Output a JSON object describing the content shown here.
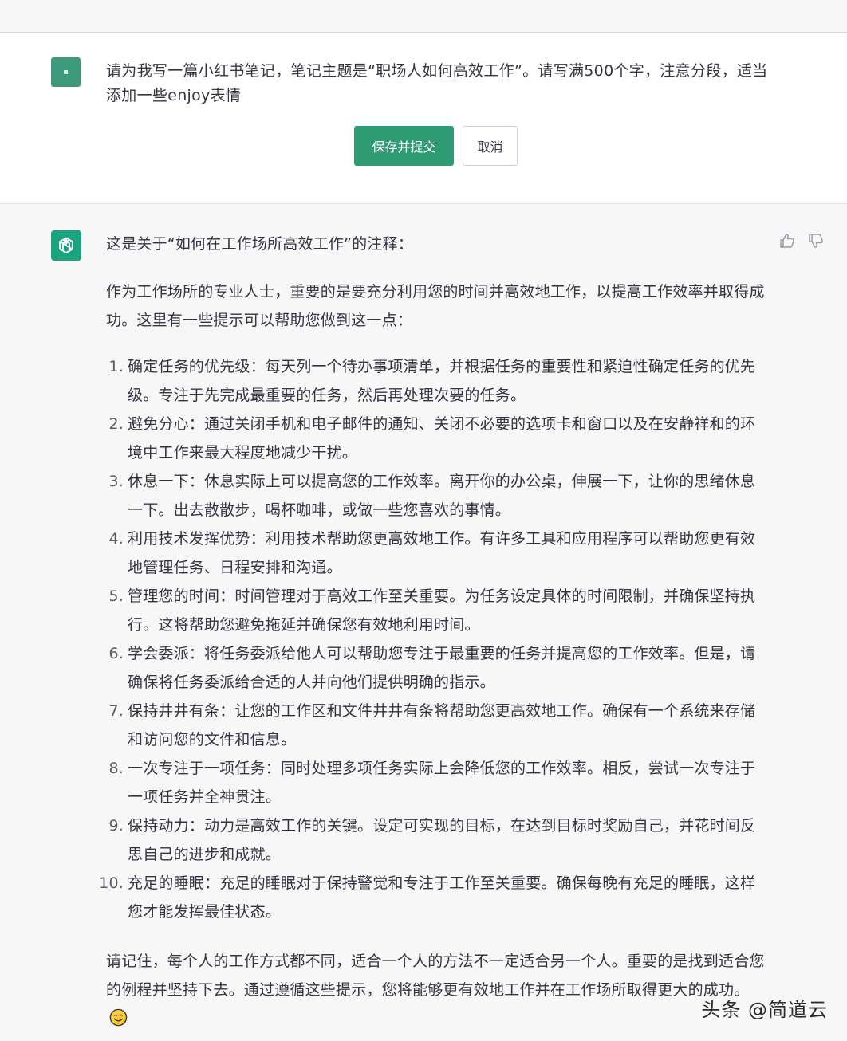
{
  "user_message": {
    "text": "请为我写一篇小红书笔记，笔记主题是“职场人如何高效工作”。请写满500个字，注意分段，适当添加一些enjoy表情",
    "save_label": "保存并提交",
    "cancel_label": "取消"
  },
  "assistant_message": {
    "intro": "这是关于“如何在工作场所高效工作”的注释：",
    "paragraph": "作为工作场所的专业人士，重要的是要充分利用您的时间并高效地工作，以提高工作效率并取得成功。这里有一些提示可以帮助您做到这一点：",
    "items": [
      {
        "num": "1.",
        "text": "确定任务的优先级：每天列一个待办事项清单，并根据任务的重要性和紧迫性确定任务的优先级。专注于先完成最重要的任务，然后再处理次要的任务。"
      },
      {
        "num": "2.",
        "text": "避免分心：通过关闭手机和电子邮件的通知、关闭不必要的选项卡和窗口以及在安静祥和的环境中工作来最大程度地减少干扰。"
      },
      {
        "num": "3.",
        "text": "休息一下：休息实际上可以提高您的工作效率。离开你的办公桌，伸展一下，让你的思绪休息一下。出去散散步，喝杯咖啡，或做一些您喜欢的事情。"
      },
      {
        "num": "4.",
        "text": "利用技术发挥优势：利用技术帮助您更高效地工作。有许多工具和应用程序可以帮助您更有效地管理任务、日程安排和沟通。"
      },
      {
        "num": "5.",
        "text": "管理您的时间：时间管理对于高效工作至关重要。为任务设定具体的时间限制，并确保坚持执行。这将帮助您避免拖延并确保您有效地利用时间。"
      },
      {
        "num": "6.",
        "text": "学会委派：将任务委派给他人可以帮助您专注于最重要的任务并提高您的工作效率。但是，请确保将任务委派给合适的人并向他们提供明确的指示。"
      },
      {
        "num": "7.",
        "text": "保持井井有条：让您的工作区和文件井井有条将帮助您更高效地工作。确保有一个系统来存储和访问您的文件和信息。"
      },
      {
        "num": "8.",
        "text": "一次专注于一项任务：同时处理多项任务实际上会降低您的工作效率。相反，尝试一次专注于一项任务并全神贯注。"
      },
      {
        "num": "9.",
        "text": "保持动力：动力是高效工作的关键。设定可实现的目标，在达到目标时奖励自己，并花时间反思自己的进步和成就。"
      },
      {
        "num": "10.",
        "text": "充足的睡眠：充足的睡眠对于保持警觉和专注于工作至关重要。确保每晚有充足的睡眠，这样您才能发挥最佳状态。"
      }
    ],
    "closing": "请记住，每个人的工作方式都不同，适合一个人的方法不一定适合另一个人。重要的是找到适合您的例程并坚持下去。通过遵循这些提示，您将能够更有效地工作并在工作场所取得更大的成功。",
    "closing_emoji_icon": "smiling-face-icon"
  },
  "watermark": "头条 @简道云",
  "colors": {
    "accent": "#2e9b74",
    "bot_avatar": "#19a37f",
    "user_avatar": "#3d9a7c"
  }
}
